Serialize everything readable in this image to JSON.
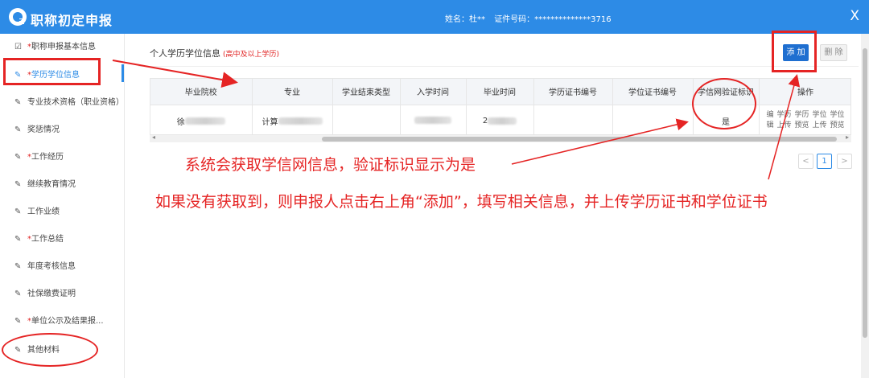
{
  "app": {
    "title": "职称初定申报",
    "user_name": "姓名：杜**",
    "id_number": "证件号码：**************3716",
    "close_label": "X"
  },
  "sidebar": {
    "items": [
      {
        "label": "职称申报基本信息",
        "required": true,
        "icon": "edit-square-icon"
      },
      {
        "label": "学历学位信息",
        "required": true,
        "icon": "pencil-icon",
        "active": true
      },
      {
        "label": "专业技术资格（职业资格）",
        "required": false,
        "icon": "pencil-icon"
      },
      {
        "label": "奖惩情况",
        "required": false,
        "icon": "pencil-icon"
      },
      {
        "label": "工作经历",
        "required": true,
        "icon": "pencil-icon"
      },
      {
        "label": "继续教育情况",
        "required": false,
        "icon": "pencil-icon"
      },
      {
        "label": "工作业绩",
        "required": false,
        "icon": "pencil-icon"
      },
      {
        "label": "工作总结",
        "required": true,
        "icon": "pencil-icon"
      },
      {
        "label": "年度考核信息",
        "required": false,
        "icon": "pencil-icon"
      },
      {
        "label": "社保缴费证明",
        "required": false,
        "icon": "pencil-icon"
      },
      {
        "label": "单位公示及结果报...",
        "required": true,
        "icon": "pencil-icon"
      },
      {
        "label": "其他材料",
        "required": false,
        "icon": "pencil-icon"
      }
    ]
  },
  "section": {
    "title": "个人学历学位信息",
    "note": "(高中及以上学历)",
    "add_button": "添 加",
    "delete_button": "删 除"
  },
  "table": {
    "headers": [
      "毕业院校",
      "专业",
      "学业结束类型",
      "入学时间",
      "毕业时间",
      "学历证书编号",
      "学位证书编号",
      "学信网验证标识",
      "操作"
    ],
    "rows": [
      {
        "school": "徐",
        "major": "计算",
        "end_type": "",
        "enroll_time": "",
        "grad_time": "2",
        "diploma_no": "",
        "degree_no": "",
        "verified": "是",
        "ops_line1": [
          "编",
          "学历",
          "学历",
          "学位",
          "学位"
        ],
        "ops_line2": [
          "辑",
          "上传",
          "预览",
          "上传",
          "预览"
        ]
      }
    ]
  },
  "pagination": {
    "prev": "<",
    "current_page": "1",
    "next": ">"
  },
  "annotations": {
    "note1": "系统会获取学信网信息，验证标识显示为是",
    "note2": "如果没有获取到，则申报人点击右上角“添加”，填写相关信息，并上传学历证书和学位证书",
    "color": "#e52424"
  },
  "colors": {
    "header_blue": "#2d8be6",
    "add_button": "#1f6fd0",
    "required_mark": "#e02020"
  }
}
